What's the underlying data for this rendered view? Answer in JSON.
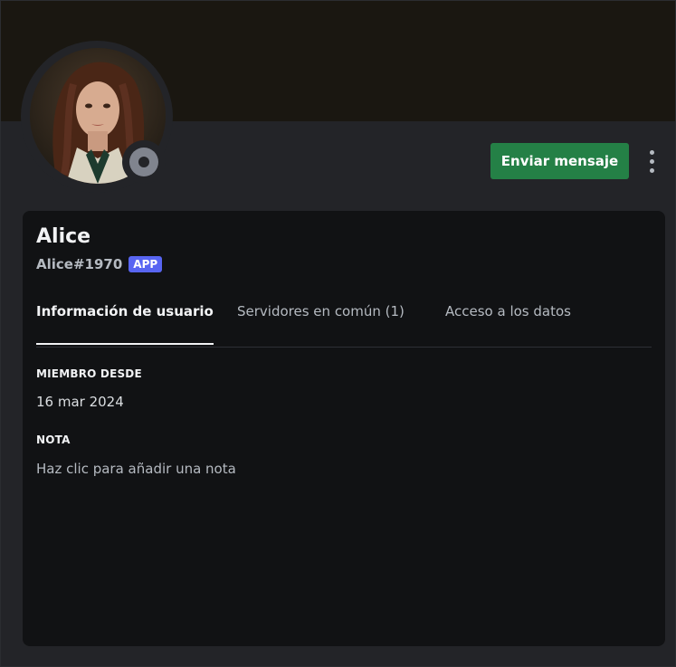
{
  "profile": {
    "display_name": "Alice",
    "username": "Alice#1970",
    "badge": "APP",
    "status": "offline",
    "avatar_alt": "Alice avatar"
  },
  "actions": {
    "send_message_label": "Enviar mensaje",
    "more_icon": "more-vertical-icon"
  },
  "tabs": [
    {
      "label": "Información de usuario",
      "active": true
    },
    {
      "label": "Servidores en común (1)",
      "active": false
    },
    {
      "label": "Acceso a los datos",
      "active": false
    }
  ],
  "member_since": {
    "title": "MIEMBRO DESDE",
    "value": "16 mar 2024"
  },
  "note": {
    "title": "NOTA",
    "placeholder": "Haz clic para añadir una nota"
  },
  "colors": {
    "accent_green": "#248046",
    "badge_blurple": "#5865f2",
    "status_offline": "#80848e",
    "banner": "#1a1711"
  }
}
